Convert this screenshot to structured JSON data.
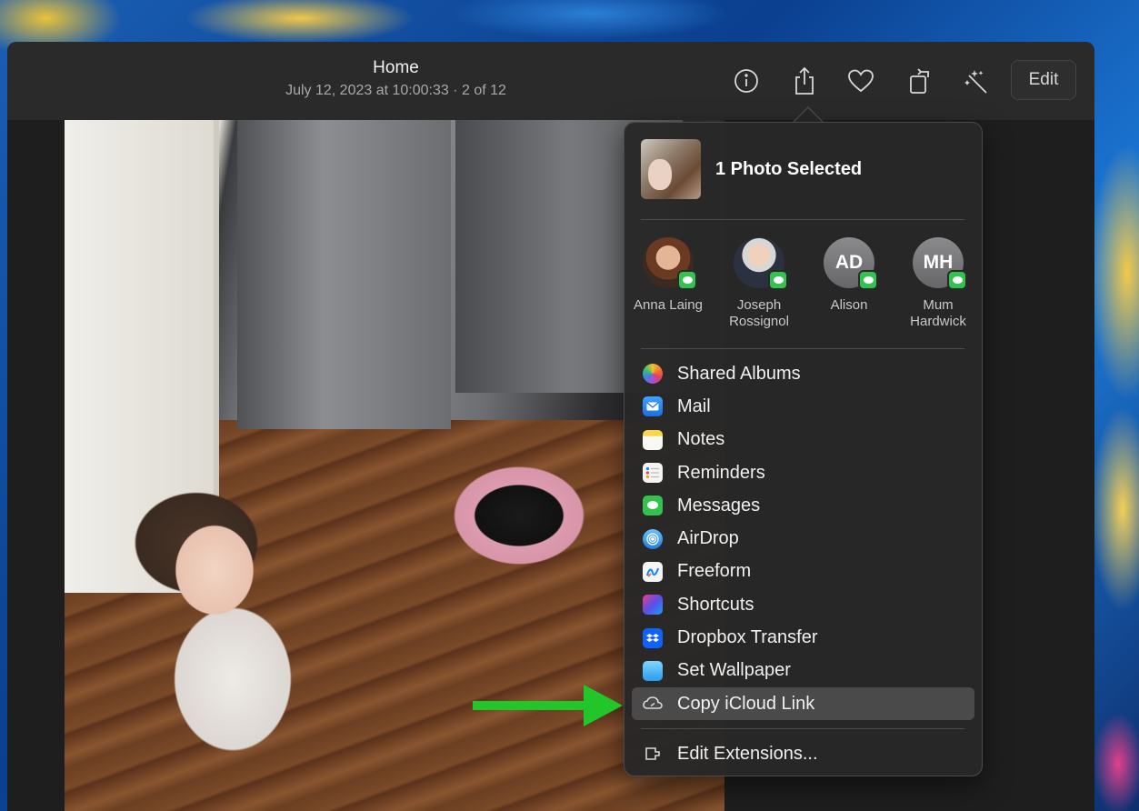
{
  "window": {
    "title": "Home",
    "subtitle": "July 12, 2023 at 10:00:33 · 2 of 12"
  },
  "toolbar": {
    "icons": [
      "info-icon",
      "share-icon",
      "heart-icon",
      "rotate-icon",
      "auto-enhance-icon"
    ],
    "edit_label": "Edit"
  },
  "share_sheet": {
    "selected_label": "1 Photo Selected",
    "contacts": [
      {
        "name": "Anna Laing",
        "initials": ""
      },
      {
        "name": "Joseph Rossignol",
        "initials": ""
      },
      {
        "name": "Alison",
        "initials": "AD"
      },
      {
        "name": "Mum Hardwick",
        "initials": "MH"
      }
    ],
    "menu": [
      {
        "label": "Shared Albums",
        "icon": "shared-albums-icon"
      },
      {
        "label": "Mail",
        "icon": "mail-icon"
      },
      {
        "label": "Notes",
        "icon": "notes-icon"
      },
      {
        "label": "Reminders",
        "icon": "reminders-icon"
      },
      {
        "label": "Messages",
        "icon": "messages-icon"
      },
      {
        "label": "AirDrop",
        "icon": "airdrop-icon"
      },
      {
        "label": "Freeform",
        "icon": "freeform-icon"
      },
      {
        "label": "Shortcuts",
        "icon": "shortcuts-icon"
      },
      {
        "label": "Dropbox Transfer",
        "icon": "dropbox-icon"
      },
      {
        "label": "Set Wallpaper",
        "icon": "wallpaper-icon"
      },
      {
        "label": "Copy iCloud Link",
        "icon": "link-icon",
        "highlighted": true
      }
    ],
    "edit_extensions_label": "Edit Extensions..."
  },
  "colors": {
    "annotation_arrow": "#22c52a",
    "highlight": "#4a4a4b",
    "message_badge": "#32c24d"
  }
}
